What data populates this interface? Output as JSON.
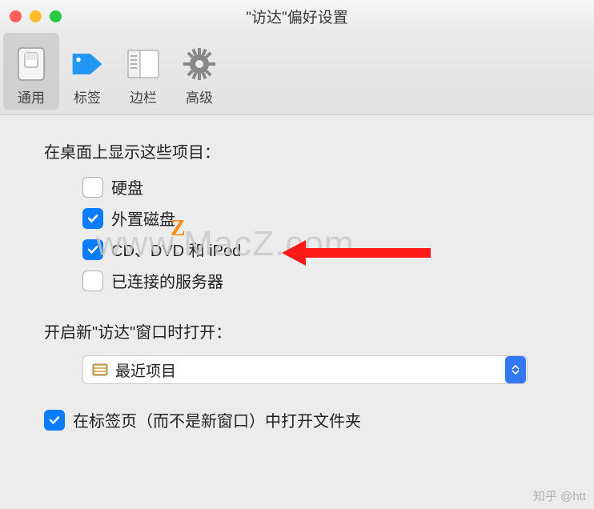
{
  "window": {
    "title": "\"访达\"偏好设置"
  },
  "toolbar": {
    "tabs": [
      {
        "label": "通用",
        "selected": true
      },
      {
        "label": "标签",
        "selected": false
      },
      {
        "label": "边栏",
        "selected": false
      },
      {
        "label": "高级",
        "selected": false
      }
    ]
  },
  "section_desktop": {
    "label": "在桌面上显示这些项目：",
    "items": [
      {
        "label": "硬盘",
        "checked": false
      },
      {
        "label": "外置磁盘",
        "checked": true
      },
      {
        "label": "CD、DVD 和 iPod",
        "checked": true
      },
      {
        "label": "已连接的服务器",
        "checked": false
      }
    ]
  },
  "section_new_window": {
    "label": "开启新\"访达\"窗口时打开：",
    "selected": "最近项目"
  },
  "bottom_checkbox": {
    "label": "在标签页（而不是新窗口）中打开文件夹",
    "checked": true
  },
  "overlay": {
    "watermark": "www.MacZ.com",
    "wm_accent": "Z",
    "source_mark": "知乎 @htt"
  }
}
